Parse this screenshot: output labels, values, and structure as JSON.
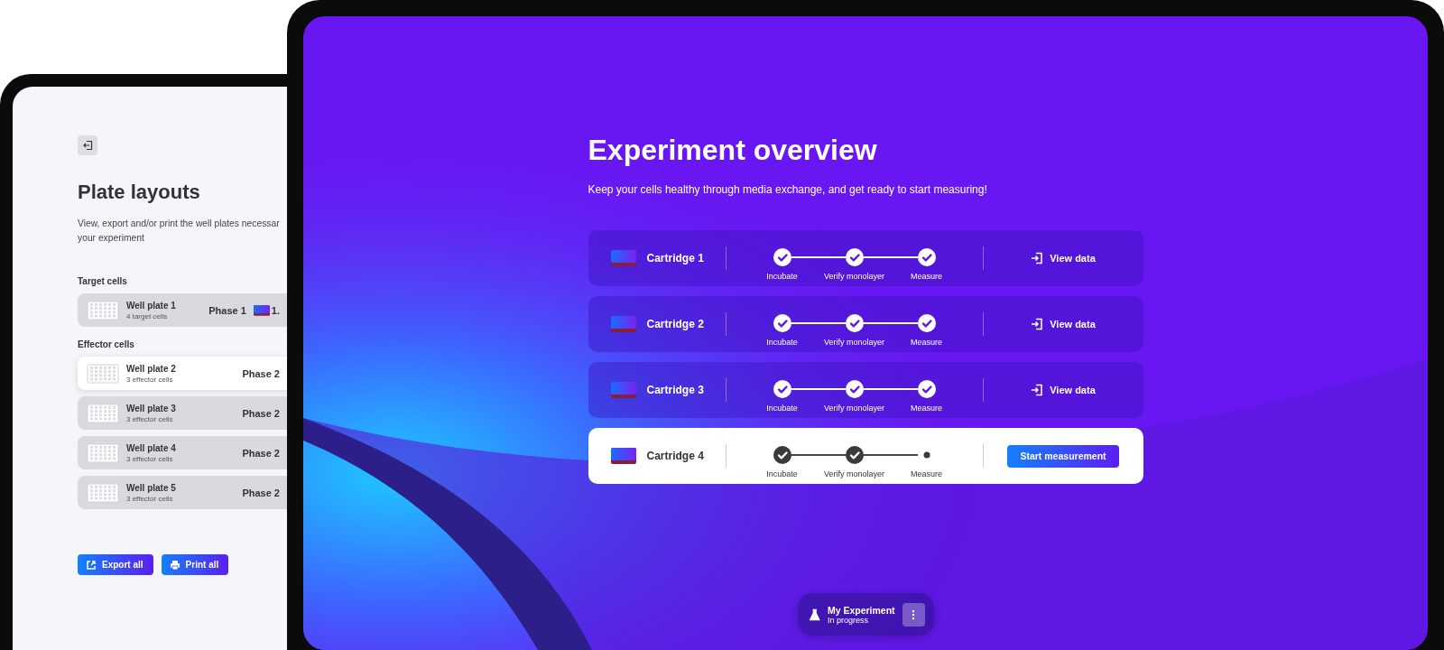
{
  "plate_layouts": {
    "title": "Plate layouts",
    "description_lines": [
      "View, export and/or print the well plates necessar",
      "your experiment"
    ],
    "sections": [
      {
        "heading": "Target cells",
        "plates": [
          {
            "name": "Well plate 1",
            "detail": "4 target cells",
            "phase": "Phase 1",
            "extra": "1.",
            "selected": false
          }
        ]
      },
      {
        "heading": "Effector cells",
        "plates": [
          {
            "name": "Well plate 2",
            "detail": "3 effector cells",
            "phase": "Phase 2",
            "selected": true
          },
          {
            "name": "Well plate 3",
            "detail": "3 effector cells",
            "phase": "Phase 2",
            "selected": false
          },
          {
            "name": "Well plate 4",
            "detail": "3 effector cells",
            "phase": "Phase 2",
            "selected": false
          },
          {
            "name": "Well plate 5",
            "detail": "3 effector cells",
            "phase": "Phase 2",
            "selected": false
          }
        ]
      }
    ],
    "buttons": [
      {
        "kind": "export",
        "label": "Export all"
      },
      {
        "kind": "print",
        "label": "Print all"
      }
    ]
  },
  "experiment": {
    "title": "Experiment overview",
    "subtitle": "Keep your cells healthy through media exchange, and get ready to start measuring!",
    "cartridges": [
      {
        "name": "Cartridge 1",
        "selected": false,
        "steps": [
          {
            "label": "Incubate",
            "done": true
          },
          {
            "label": "Verify monolayer",
            "done": true
          },
          {
            "label": "Measure",
            "done": true
          }
        ],
        "action": {
          "kind": "link",
          "label": "View data"
        }
      },
      {
        "name": "Cartridge 2",
        "selected": false,
        "steps": [
          {
            "label": "Incubate",
            "done": true
          },
          {
            "label": "Verify monolayer",
            "done": true
          },
          {
            "label": "Measure",
            "done": true
          }
        ],
        "action": {
          "kind": "link",
          "label": "View data"
        }
      },
      {
        "name": "Cartridge 3",
        "selected": false,
        "steps": [
          {
            "label": "Incubate",
            "done": true
          },
          {
            "label": "Verify monolayer",
            "done": true
          },
          {
            "label": "Measure",
            "done": true
          }
        ],
        "action": {
          "kind": "link",
          "label": "View data"
        }
      },
      {
        "name": "Cartridge 4",
        "selected": true,
        "steps": [
          {
            "label": "Incubate",
            "done": true
          },
          {
            "label": "Verify monolayer",
            "done": true
          },
          {
            "label": "Measure",
            "done": false
          }
        ],
        "action": {
          "kind": "button",
          "label": "Start measurement"
        }
      }
    ],
    "status": {
      "name": "My Experiment",
      "state": "In progress"
    }
  }
}
